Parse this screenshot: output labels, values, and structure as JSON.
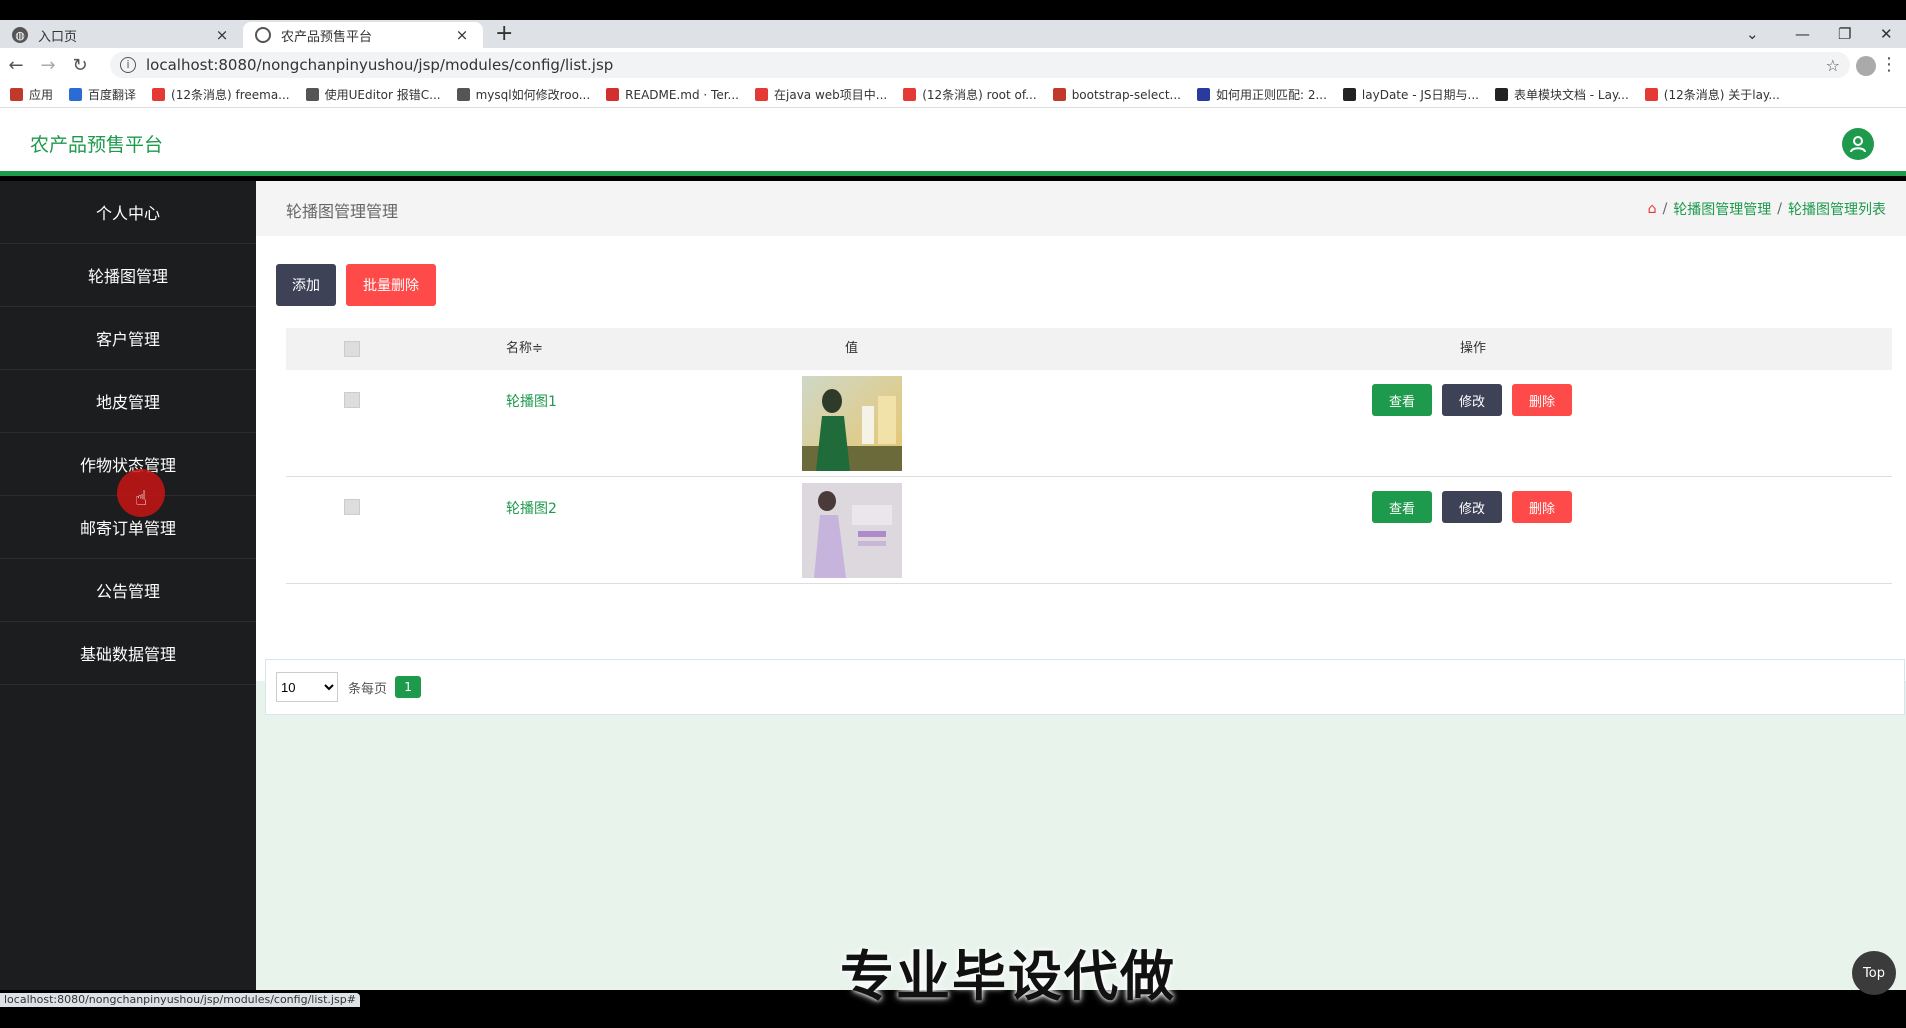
{
  "browser": {
    "tabs": [
      {
        "title": "入口页",
        "close": "×"
      },
      {
        "title": "农产品预售平台",
        "close": "×"
      }
    ],
    "new_tab": "+",
    "window_controls": [
      "—",
      "❐",
      "✕"
    ],
    "url": "localhost:8080/nongchanpinyushou/jsp/modules/config/list.jsp",
    "bookmarks": [
      {
        "label": "应用",
        "color": "#c0392b"
      },
      {
        "label": "百度翻译",
        "color": "#2b6cd4"
      },
      {
        "label": "(12条消息) freema...",
        "color": "#e53935"
      },
      {
        "label": "使用UEditor 报错C...",
        "color": "#555555"
      },
      {
        "label": "mysql如何修改roo...",
        "color": "#555555"
      },
      {
        "label": "README.md · Ter...",
        "color": "#d32f2f"
      },
      {
        "label": "在java web项目中...",
        "color": "#e53935"
      },
      {
        "label": "(12条消息) root of...",
        "color": "#e53935"
      },
      {
        "label": "bootstrap-select...",
        "color": "#c0392b"
      },
      {
        "label": "如何用正则匹配: 2...",
        "color": "#2b3a9e"
      },
      {
        "label": "layDate - JS日期与...",
        "color": "#222222"
      },
      {
        "label": "表单模块文档 - Lay...",
        "color": "#222222"
      },
      {
        "label": "(12条消息) 关于lay...",
        "color": "#e53935"
      }
    ],
    "status_url": "localhost:8080/nongchanpinyushou/jsp/modules/config/list.jsp#"
  },
  "header": {
    "brand": "农产品预售平台"
  },
  "sidebar": {
    "items": [
      {
        "label": "个人中心"
      },
      {
        "label": "轮播图管理"
      },
      {
        "label": "客户管理"
      },
      {
        "label": "地皮管理"
      },
      {
        "label": "作物状态管理"
      },
      {
        "label": "邮寄订单管理"
      },
      {
        "label": "公告管理"
      },
      {
        "label": "基础数据管理"
      }
    ]
  },
  "main": {
    "page_title": "轮播图管理管理",
    "breadcrumb": [
      "轮播图管理管理",
      "轮播图管理列表"
    ],
    "breadcrumb_sep": "/",
    "toolbar": {
      "add_label": "添加",
      "batch_delete_label": "批量删除"
    },
    "table": {
      "columns": {
        "name": "名称≑",
        "value": "值",
        "actions": "操作"
      },
      "rows": [
        {
          "name": "轮播图1"
        },
        {
          "name": "轮播图2"
        }
      ],
      "action_labels": {
        "view": "查看",
        "edit": "修改",
        "delete": "删除"
      }
    },
    "pager": {
      "page_size": "10",
      "page_size_options": [
        "10"
      ],
      "per_page_label": "条每页",
      "current_page": "1"
    }
  },
  "overlay": {
    "watermark": "专业毕设代做",
    "top_button": "Top"
  },
  "colors": {
    "accent": "#1d9a4c",
    "danger": "#ff4a4a",
    "dark_button": "#3e4257",
    "sidebar": "#1c1d1f"
  }
}
